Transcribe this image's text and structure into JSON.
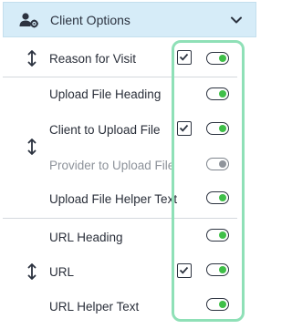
{
  "header": {
    "title": "Client Options",
    "icon": "users-gear-icon",
    "chevron": "chevron-down-icon"
  },
  "rows": [
    {
      "label": "Reason for Visit",
      "has_checkbox": true,
      "checked": true,
      "toggle_on": true,
      "disabled": false
    },
    {
      "label": "Upload File Heading",
      "has_checkbox": false,
      "checked": false,
      "toggle_on": true,
      "disabled": false
    },
    {
      "label": "Client to Upload File",
      "has_checkbox": true,
      "checked": true,
      "toggle_on": true,
      "disabled": false
    },
    {
      "label": "Provider to Upload File",
      "has_checkbox": false,
      "checked": false,
      "toggle_on": false,
      "disabled": true
    },
    {
      "label": "Upload File Helper Text",
      "has_checkbox": false,
      "checked": false,
      "toggle_on": true,
      "disabled": false
    },
    {
      "label": "URL Heading",
      "has_checkbox": false,
      "checked": false,
      "toggle_on": true,
      "disabled": false
    },
    {
      "label": "URL",
      "has_checkbox": true,
      "checked": true,
      "toggle_on": true,
      "disabled": false
    },
    {
      "label": "URL Helper Text",
      "has_checkbox": false,
      "checked": false,
      "toggle_on": true,
      "disabled": false
    }
  ],
  "colors": {
    "header_bg": "#d6ecf8",
    "toggle_on": "#3fbf48",
    "highlight": "#8fe0b7"
  }
}
